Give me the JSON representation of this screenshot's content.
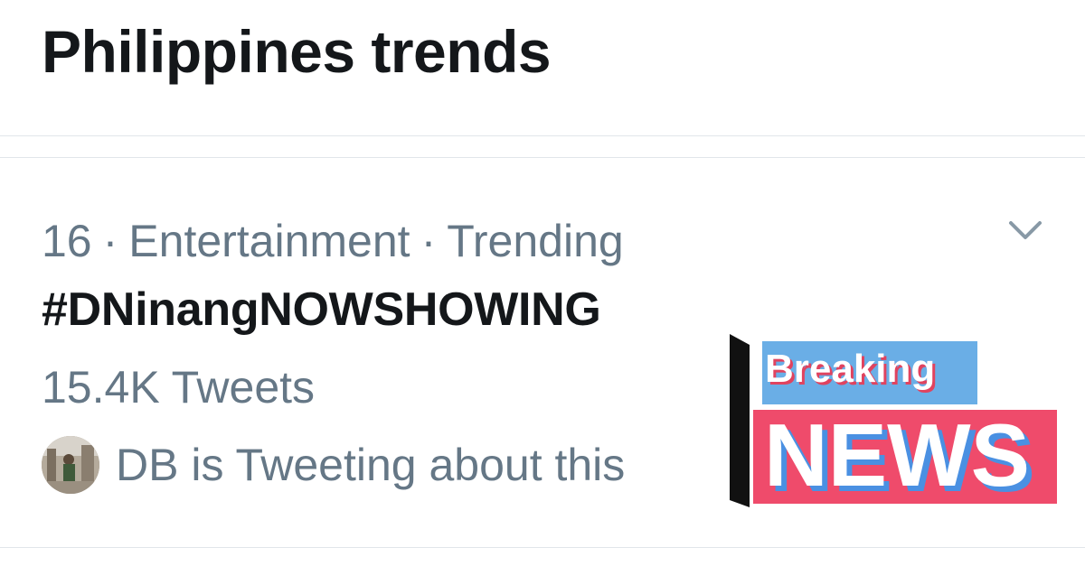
{
  "header": {
    "title": "Philippines trends"
  },
  "trend": {
    "rank": "16",
    "separator": "·",
    "category": "Entertainment",
    "status": "Trending",
    "name": "#DNinangNOWSHOWING",
    "tweet_count": "15.4K Tweets",
    "tweeting_about": "DB is Tweeting about this",
    "more_icon": "chevron-down-icon"
  },
  "overlay": {
    "breaking_label": "Breaking",
    "news_label": "NEWS",
    "colors": {
      "breaking_bg": "#6aaee6",
      "breaking_text": "#ffffff",
      "breaking_shadow": "#e0435f",
      "news_bg": "#ef4b6b",
      "news_text": "#ffffff",
      "news_shadow": "#4a90e2",
      "bar": "#111111"
    }
  },
  "theme": {
    "text_primary": "#14171a",
    "text_secondary": "#657786",
    "divider": "#e1e6ea"
  }
}
